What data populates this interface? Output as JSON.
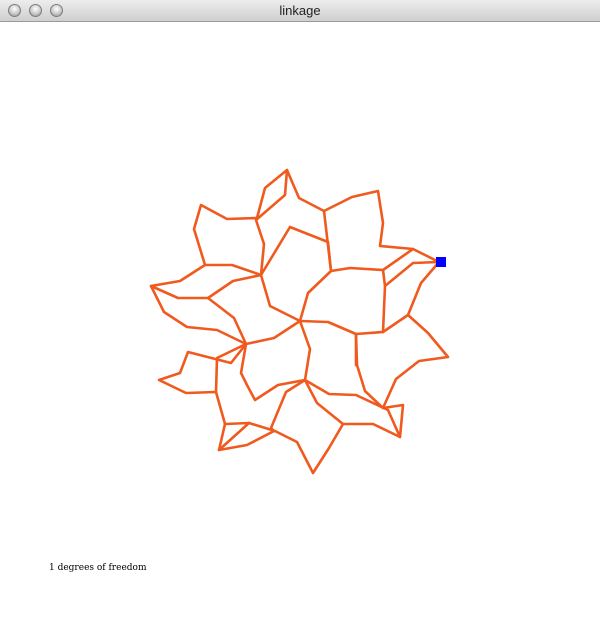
{
  "window": {
    "title": "linkage",
    "link_color": "#f05a1e",
    "handle_color": "#0000ff"
  },
  "status": {
    "freedom_text": "1 degrees of freedom"
  }
}
